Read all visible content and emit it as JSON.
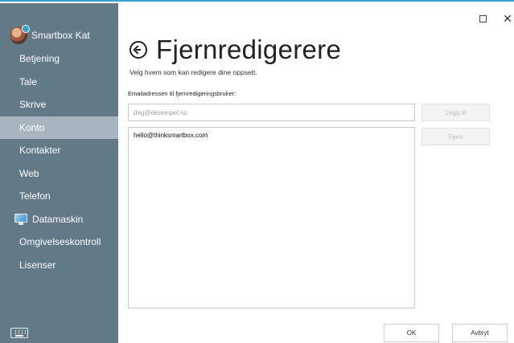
{
  "window": {
    "close_glyph": "✕"
  },
  "sidebar": {
    "user_name": "Smartbox Kat",
    "items": [
      {
        "label": "Betjening",
        "active": false
      },
      {
        "label": "Tale",
        "active": false
      },
      {
        "label": "Skrive",
        "active": false
      },
      {
        "label": "Konto",
        "active": true
      },
      {
        "label": "Kontakter",
        "active": false
      },
      {
        "label": "Web",
        "active": false
      },
      {
        "label": "Telefon",
        "active": false
      },
      {
        "label": "Datamaskin",
        "active": false,
        "icon": "monitor-icon"
      },
      {
        "label": "Omgivelseskontroll",
        "active": false
      },
      {
        "label": "Lisenser",
        "active": false
      }
    ],
    "keyboard_icon": "keyboard-icon"
  },
  "header": {
    "title": "Fjernredigerere",
    "subtitle": "Velg hvem som kan redigere dine oppsett.",
    "back_icon": "back-arrow-icon"
  },
  "form": {
    "email_label": "Emailadressen til fjernredigeringsbruker:",
    "email_placeholder": "deg@eksempel.no",
    "email_value": "",
    "add_label": "Legg til",
    "remove_label": "Fjern",
    "emails": [
      "hello@thinksmartbox.com"
    ]
  },
  "footer": {
    "ok_label": "OK",
    "cancel_label": "Avbryt"
  },
  "colors": {
    "sidebar_bg": "#627987",
    "sidebar_active": "#a6b5bf",
    "accent": "#2ea3dd"
  }
}
